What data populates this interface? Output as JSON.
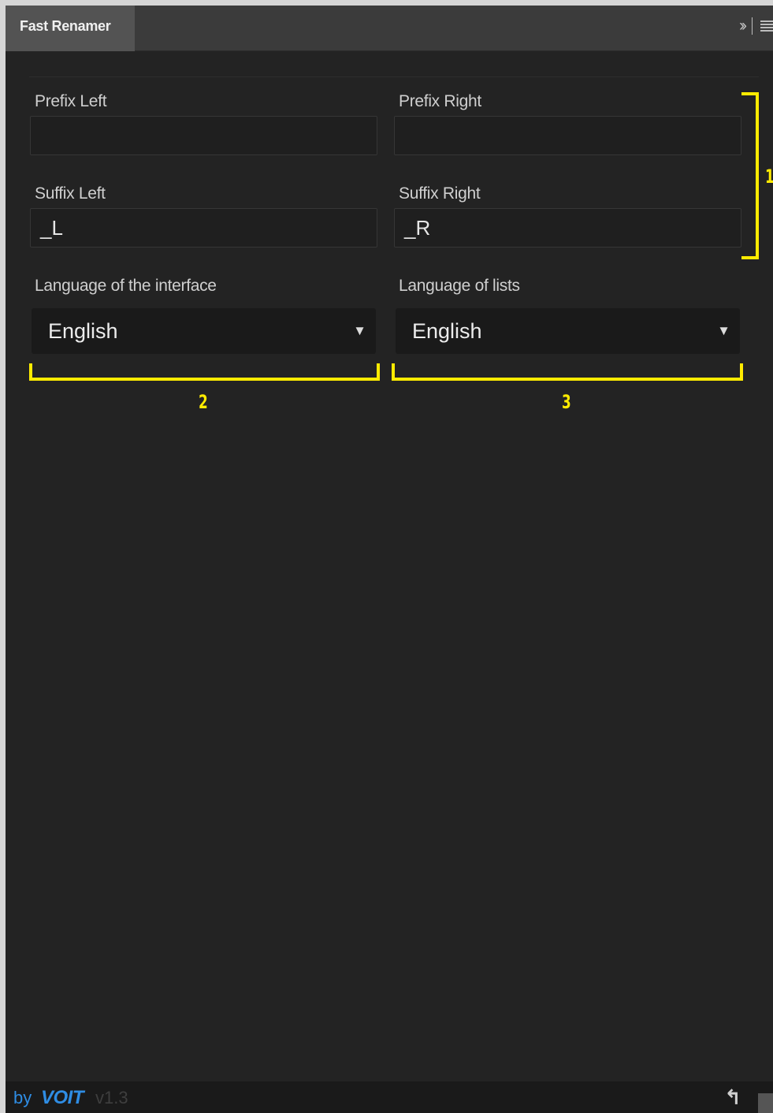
{
  "tab": {
    "title": "Fast Renamer",
    "overflow_icon": "double-chevron-right-icon",
    "menu_icon": "hamburger-menu-icon"
  },
  "fields": {
    "prefix_left": {
      "label": "Prefix Left",
      "value": ""
    },
    "prefix_right": {
      "label": "Prefix Right",
      "value": ""
    },
    "suffix_left": {
      "label": "Suffix Left",
      "value": "_L"
    },
    "suffix_right": {
      "label": "Suffix Right",
      "value": "_R"
    }
  },
  "selects": {
    "interface_language": {
      "label": "Language of the interface",
      "selected": "English"
    },
    "list_language": {
      "label": "Language of lists",
      "selected": "English"
    }
  },
  "annotations": [
    "1",
    "2",
    "3"
  ],
  "footer": {
    "by": "by",
    "brand": "VOIT",
    "version": "v1.3",
    "undo_icon": "undo-arrow-icon"
  },
  "colors": {
    "panel_bg": "#232323",
    "annotation": "#ffeb00",
    "brand": "#2f8de4"
  }
}
